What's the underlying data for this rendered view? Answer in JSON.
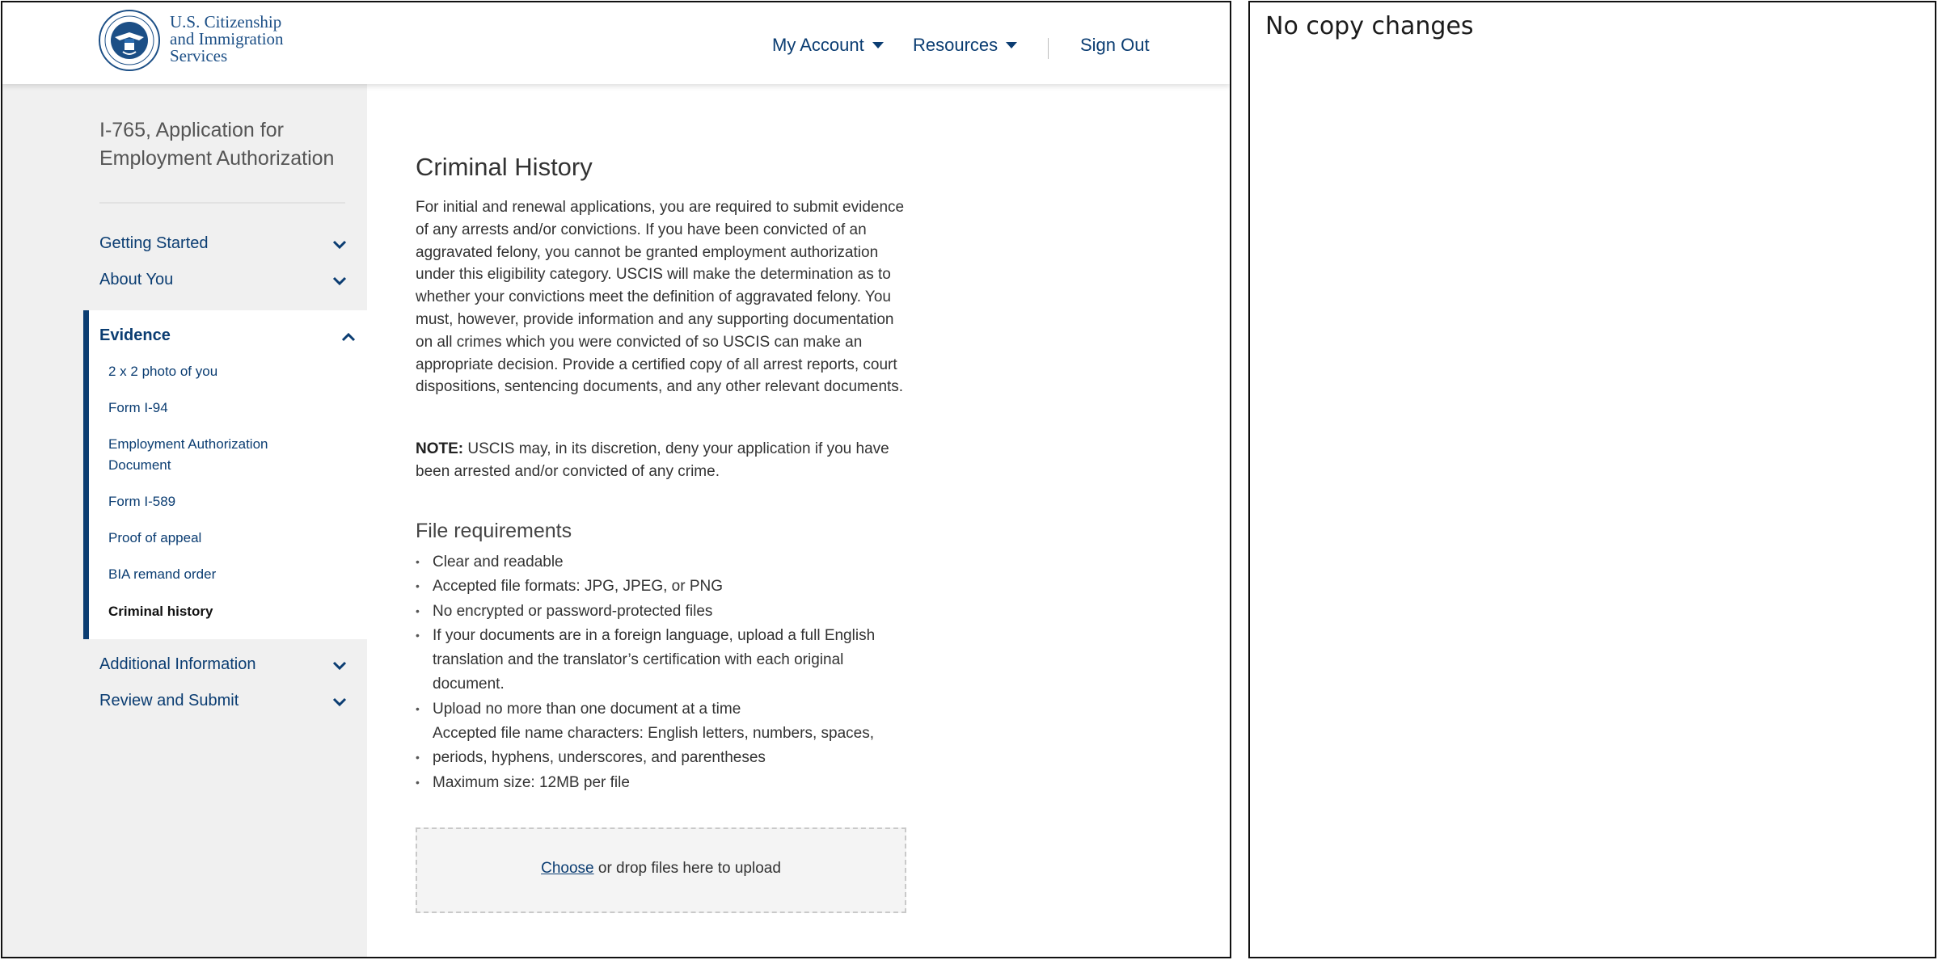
{
  "header": {
    "agency_lines": [
      "U.S. Citizenship",
      "and Immigration",
      "Services"
    ],
    "nav": {
      "my_account": "My Account",
      "resources": "Resources",
      "sign_out": "Sign Out"
    },
    "brand_color": "#1c4f86",
    "seal_icon": "dhs-seal-icon"
  },
  "sidebar": {
    "title": "I-765, Application for Employment Authorization",
    "sections": [
      {
        "label": "Getting Started",
        "state": "collapsed"
      },
      {
        "label": "About You",
        "state": "collapsed"
      },
      {
        "label": "Evidence",
        "state": "expanded"
      },
      {
        "label": "Additional Information",
        "state": "collapsed"
      },
      {
        "label": "Review and Submit",
        "state": "collapsed"
      }
    ],
    "evidence_items": [
      "2 x 2 photo of you",
      "Form I-94",
      "Employment Authorization Document",
      "Form I-589",
      "Proof of appeal",
      "BIA remand order",
      "Criminal history"
    ],
    "active_item": "Criminal history",
    "accent_color": "#0b3d72"
  },
  "main": {
    "title": "Criminal History",
    "intro": "For initial and renewal applications, you are required to submit evidence of any arrests and/or convictions. If you have been convicted of an aggravated felony, you cannot be granted employment authorization under this eligibility category. USCIS will make the determination as to whether your convictions meet the definition of aggravated felony. You must, however, provide information and any supporting documentation on all crimes which you were convicted of so USCIS can make an appropriate decision. Provide a certified copy of all arrest reports, court dispositions, sentencing documents, and any other relevant documents.",
    "note_label": "NOTE:",
    "note_text": " USCIS may, in its discretion, deny your application if you have been arrested and/or convicted of any crime.",
    "file_req_title": "File requirements",
    "file_requirements": [
      "Clear and readable",
      "Accepted file formats: JPG, JPEG, or PNG",
      "No encrypted or password-protected files",
      "If your documents are in a foreign language,  upload a full English translation and the translator’s certification with each original document.",
      "Upload no more than one document at a time",
      "Accepted file name characters: English letters, numbers, spaces,",
      "periods, hyphens, underscores, and parentheses",
      "Maximum size: 12MB per file"
    ],
    "upload_link": "Choose",
    "upload_text": " or drop files here to upload"
  },
  "right_panel": {
    "note": "No copy changes"
  }
}
